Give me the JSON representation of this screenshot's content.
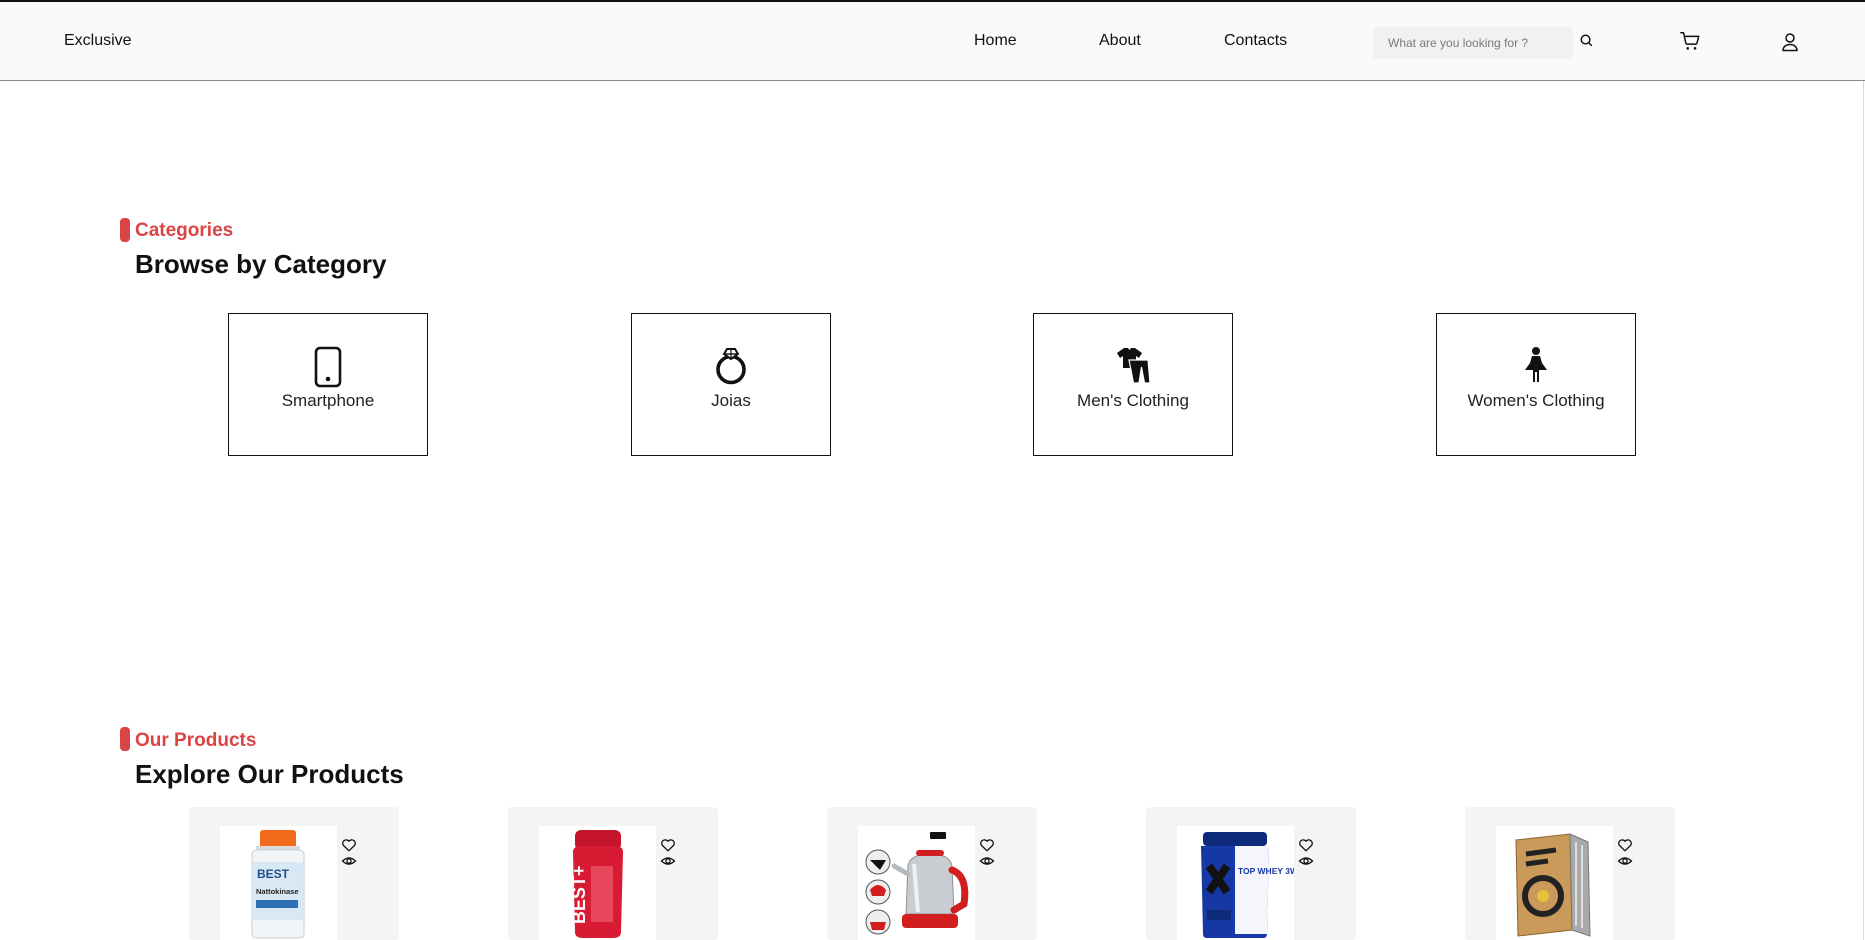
{
  "header": {
    "logo": "Exclusive",
    "nav": [
      "Home",
      "About",
      "Contacts"
    ],
    "search_placeholder": "What are you looking for ?"
  },
  "categories_section": {
    "eyebrow": "Categories",
    "title": "Browse by Category",
    "items": [
      {
        "label": "Smartphone",
        "icon": "smartphone-icon"
      },
      {
        "label": "Joias",
        "icon": "ring-icon"
      },
      {
        "label": "Men's Clothing",
        "icon": "mens-clothing-icon"
      },
      {
        "label": "Women's Clothing",
        "icon": "womens-clothing-icon"
      }
    ]
  },
  "products_section": {
    "eyebrow": "Our Products",
    "title": "Explore Our Products",
    "products": [
      {
        "image": "supplement-bottle-image",
        "image_text": [
          "BEST",
          "Nattokinase"
        ]
      },
      {
        "image": "red-hair-powder-image",
        "image_text": [
          "BEST+"
        ]
      },
      {
        "image": "electric-kettle-image",
        "image_text": []
      },
      {
        "image": "whey-protein-tub-image",
        "image_text": [
          "TOP WHEY 3W"
        ]
      },
      {
        "image": "book-image",
        "image_text": []
      }
    ]
  },
  "colors": {
    "accent": "#db4444",
    "header_bg": "#fafafa",
    "product_card_bg": "#f4f4f4"
  }
}
